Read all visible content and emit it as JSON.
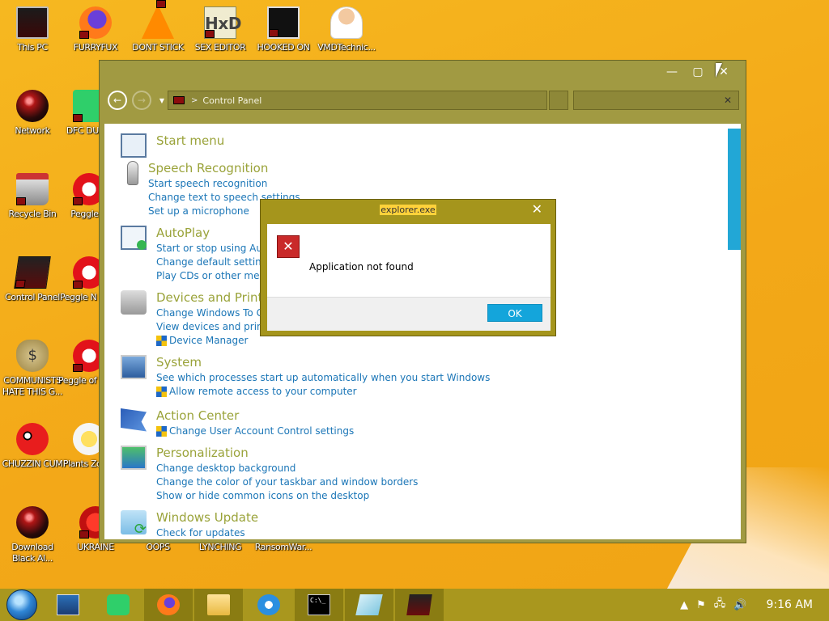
{
  "desktop": {
    "icons": [
      {
        "label": "This PC",
        "icon": "monitor-icon"
      },
      {
        "label": "FURRYFUX",
        "icon": "firefox-icon"
      },
      {
        "label": "DONT STICK",
        "icon": "vlc-cone-icon"
      },
      {
        "label": "SEX EDITOR",
        "icon": "hxd-icon"
      },
      {
        "label": "HOOKED ON",
        "icon": "hooked-icon"
      },
      {
        "label": "VMDTechnic...",
        "icon": "doctor-icon"
      },
      {
        "label": "Network",
        "icon": "red-orb-icon"
      },
      {
        "label": "DFC DUMB",
        "icon": "green-app-icon"
      },
      {
        "label": "Recycle Bin",
        "icon": "recycle-bin-icon"
      },
      {
        "label": "Peggle D",
        "icon": "peggle-icon"
      },
      {
        "label": "Control Panel",
        "icon": "control-panel-icon"
      },
      {
        "label": "Peggle N Delu",
        "icon": "peggle-icon"
      },
      {
        "label": "COMMUNISTS HATE THIS G...",
        "icon": "money-bag-icon"
      },
      {
        "label": "Peggle of Warc",
        "icon": "peggle-icon"
      },
      {
        "label": "CHUZZIN CUM",
        "icon": "chuzzle-icon"
      },
      {
        "label": "Plants Zomb",
        "icon": "plant-icon"
      },
      {
        "label": "Download Black Al...",
        "icon": "red-orb-icon"
      },
      {
        "label": "UKRAINE",
        "icon": "ukraine-icon"
      },
      {
        "label": "OOPS",
        "icon": "none"
      },
      {
        "label": "LYNCHING",
        "icon": "none"
      },
      {
        "label": "RansomWar...",
        "icon": "none"
      }
    ]
  },
  "window": {
    "address": {
      "path_sep": ">",
      "location": "Control Panel"
    },
    "search": {
      "placeholder": "",
      "clear": "✕"
    },
    "controls": {
      "minimize": "—",
      "maximize": "▢",
      "close": "✕"
    },
    "categories": [
      {
        "title": "Start menu",
        "icon": "start-menu-icon",
        "links": []
      },
      {
        "title": "Speech Recognition",
        "icon": "microphone-icon",
        "links": [
          {
            "text": "Start speech recognition",
            "shield": false
          },
          {
            "text": "Change text to speech settings",
            "shield": false
          },
          {
            "text": "Set up a microphone",
            "shield": false
          }
        ]
      },
      {
        "title": "AutoPlay",
        "icon": "autoplay-icon",
        "links": [
          {
            "text": "Start or stop using AutoPlay for all media and devices",
            "shield": false
          },
          {
            "text": "Change default settings for media or devices",
            "shield": false
          },
          {
            "text": "Play CDs or other media automatically",
            "shield": false
          }
        ]
      },
      {
        "title": "Devices and Printers",
        "icon": "printer-icon",
        "links": [
          {
            "text": "Change Windows To Go startup options",
            "shield": false
          },
          {
            "text": "View devices and printers",
            "shield": false
          },
          {
            "text": "Device Manager",
            "shield": true
          }
        ]
      },
      {
        "title": "System",
        "icon": "system-icon",
        "links": [
          {
            "text": "See which processes start up automatically when you start Windows",
            "shield": false
          },
          {
            "text": "Allow remote access to your computer",
            "shield": true
          }
        ]
      },
      {
        "title": "Action Center",
        "icon": "action-center-flag-icon",
        "links": [
          {
            "text": "Change User Account Control settings",
            "shield": true
          }
        ]
      },
      {
        "title": "Personalization",
        "icon": "personalization-icon",
        "links": [
          {
            "text": "Change desktop background",
            "shield": false
          },
          {
            "text": "Change the color of your taskbar and window borders",
            "shield": false
          },
          {
            "text": "Show or hide common icons on the desktop",
            "shield": false
          }
        ]
      },
      {
        "title": "Windows Update",
        "icon": "windows-update-icon",
        "links": [
          {
            "text": "Check for updates",
            "shield": false
          }
        ]
      }
    ]
  },
  "dialog": {
    "title": "explorer.exe",
    "close": "✕",
    "error_glyph": "✕",
    "message": "Application not found",
    "ok_label": "OK"
  },
  "taskbar": {
    "items": [
      "window-manager-icon",
      "green-app-icon",
      "firefox-icon",
      "file-explorer-icon",
      "internet-explorer-icon",
      "command-prompt-icon",
      "notepad-icon",
      "control-panel-icon"
    ],
    "cmd_text": "C:\\_",
    "tray": {
      "flag": "⚑",
      "network": "🖧",
      "volume": "🔊",
      "up": "▲"
    },
    "clock": "9:16 AM"
  }
}
